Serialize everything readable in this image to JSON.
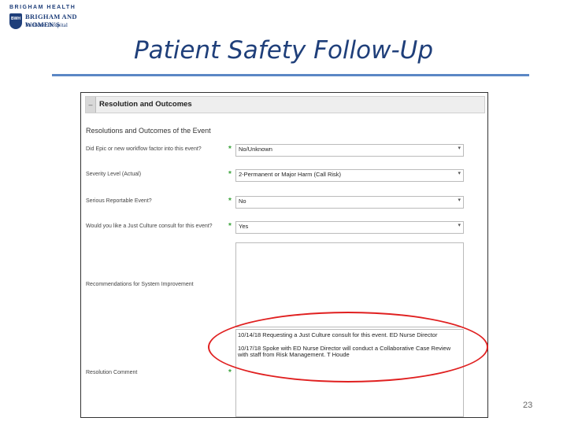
{
  "logo": {
    "top_text": "BRIGHAM HEALTH",
    "seal_text": "BWH",
    "name": "BRIGHAM AND WOMEN'S",
    "sub": "Faulkner Hospital"
  },
  "slide": {
    "title": "Patient Safety Follow-Up",
    "page_number": "23"
  },
  "panel": {
    "collapse_glyph": "–",
    "title": "Resolution and Outcomes",
    "section_title": "Resolutions and Outcomes of the Event"
  },
  "fields": [
    {
      "label": "Did Epic or new workflow factor into this event?",
      "value": "No/Unknown"
    },
    {
      "label": "Severity Level (Actual)",
      "value": "2-Permanent or Major Harm (Call Risk)"
    },
    {
      "label": "Serious Reportable Event?",
      "value": "No"
    },
    {
      "label": "Would you like a Just Culture consult for this event?",
      "value": "Yes"
    }
  ],
  "recommendations": {
    "label": "Recommendations for System Improvement",
    "value": ""
  },
  "resolution": {
    "label": "Resolution Comment",
    "lines": [
      "10/14/18 Requesting a Just Culture consult for this event. ED Nurse Director",
      "10/17/18 Spoke with ED Nurse Director will conduct a Collaborative Case Review",
      "with staff from Risk Management. T Houde"
    ]
  },
  "icons": {
    "caret": "caret-down-icon",
    "required": "required-star-icon"
  },
  "colors": {
    "title": "#1f3f7a",
    "rule": "#5b87c5",
    "required": "#3aa23a",
    "highlight": "#e02020"
  }
}
